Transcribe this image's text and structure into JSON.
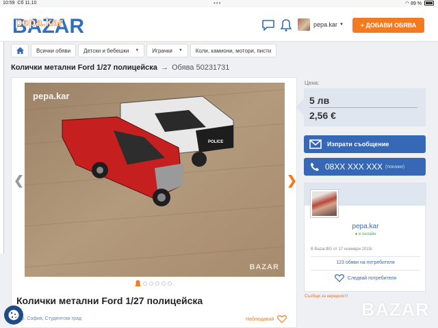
{
  "statusbar": {
    "time": "10:59",
    "date": "Сб 11.10",
    "dots": "•••",
    "battery": "89 %"
  },
  "header": {
    "logo_text": "BAZAR",
    "logo_overlay": "pepa.kar",
    "username": "pepa.kar",
    "add_button": "+ ДОБАВИ ОБЯВА"
  },
  "breadcrumbs": [
    {
      "label": "Всички обяви"
    },
    {
      "label": "Детски и бебешки"
    },
    {
      "label": "Играчки"
    },
    {
      "label": "Коли, камиони, мотори, писти"
    }
  ],
  "listing": {
    "title": "Колички метални Ford 1/27 полицейска",
    "arrow": "→",
    "ad_number": "Обява 50231731",
    "photo_watermark_top": "pepa.kar",
    "photo_watermark_bottom": "BAZAR",
    "photo_badge": "POLICE",
    "heading": "Колички метални Ford 1/27 полицейска",
    "location": "гр. София, Студентски град",
    "watch_label": "Наблюдавай"
  },
  "price": {
    "label": "Цена:",
    "lv": "5 лв",
    "eur": "2,56 €"
  },
  "contact": {
    "message_button": "Изпрати съобщение",
    "phone": "08XX XXX XXX",
    "phone_hint": "(покажи)"
  },
  "seller": {
    "name": "pepa.kar",
    "status": "● е онлайн",
    "since": "В Bazar.BG от 17 ноември 2015г.",
    "ads_count": "123 обяви на потребителя",
    "follow": "Следвай потребителя"
  },
  "report_link": "Съобщи за нередност!",
  "corner_watermark": "BAZAR",
  "colors": {
    "accent": "#f47a20",
    "primary": "#3768b5",
    "price_bg": "#dfe6f0"
  }
}
